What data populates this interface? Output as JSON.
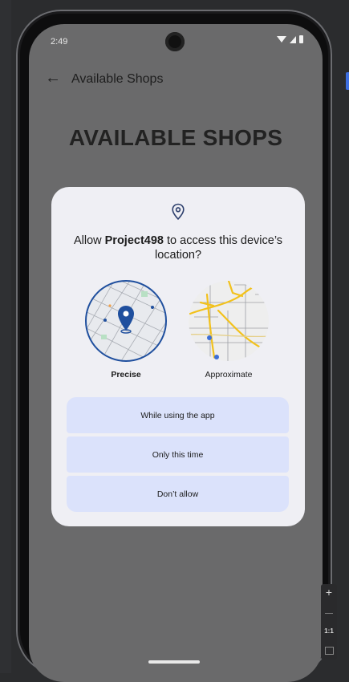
{
  "status_bar": {
    "time": "2:49"
  },
  "app_bar": {
    "title": "Available Shops"
  },
  "page": {
    "heading": "AVAILABLE SHOPS"
  },
  "dialog": {
    "title_prefix": "Allow ",
    "app_name": "Project498",
    "title_suffix": " to access this device’s location?",
    "options": [
      {
        "label": "Precise",
        "selected": true
      },
      {
        "label": "Approximate",
        "selected": false
      }
    ],
    "buttons": {
      "while_using": "While using the app",
      "only_this_time": "Only this time",
      "dont_allow": "Don’t allow"
    }
  },
  "zoom_control": {
    "plus": "+",
    "fit": "1:1"
  },
  "colors": {
    "screen_dim": "#6a6a6b",
    "dialog_bg": "#efeff4",
    "button_bg": "#dbe2fb",
    "accent_blue": "#1f4f9e",
    "map_road_yellow": "#f2c11b"
  },
  "icons": [
    "back-arrow-icon",
    "location-pin-icon",
    "wifi-icon",
    "signal-icon",
    "battery-icon"
  ]
}
